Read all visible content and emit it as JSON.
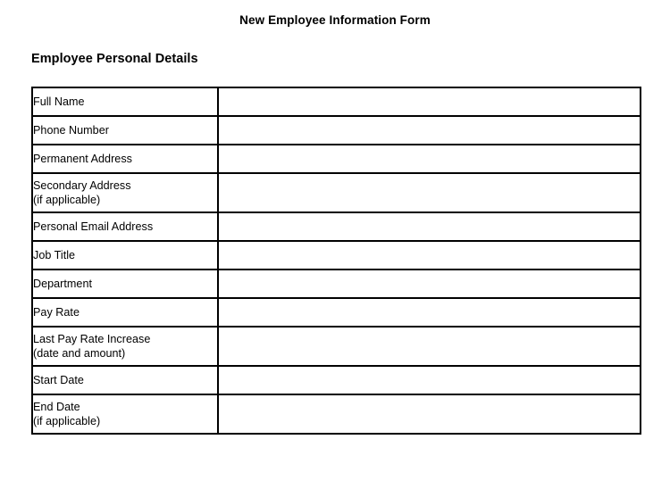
{
  "document": {
    "title": "New Employee Information Form",
    "section_heading": "Employee Personal Details"
  },
  "table": {
    "rows": [
      {
        "label": "Full Name",
        "sublabel": "",
        "value": ""
      },
      {
        "label": "Phone Number",
        "sublabel": "",
        "value": ""
      },
      {
        "label": "Permanent Address",
        "sublabel": "",
        "value": ""
      },
      {
        "label": "Secondary Address",
        "sublabel": "(if applicable)",
        "value": ""
      },
      {
        "label": "Personal Email Address",
        "sublabel": "",
        "value": ""
      },
      {
        "label": "Job Title",
        "sublabel": "",
        "value": ""
      },
      {
        "label": "Department",
        "sublabel": "",
        "value": ""
      },
      {
        "label": "Pay Rate",
        "sublabel": "",
        "value": ""
      },
      {
        "label": "Last Pay Rate Increase",
        "sublabel": "(date and amount)",
        "value": ""
      },
      {
        "label": "Start Date",
        "sublabel": "",
        "value": ""
      },
      {
        "label": "End Date",
        "sublabel": "(if applicable)",
        "value": ""
      }
    ]
  },
  "colors": {
    "page_background": "#ffffff",
    "text": "#000000",
    "border": "#000000"
  }
}
